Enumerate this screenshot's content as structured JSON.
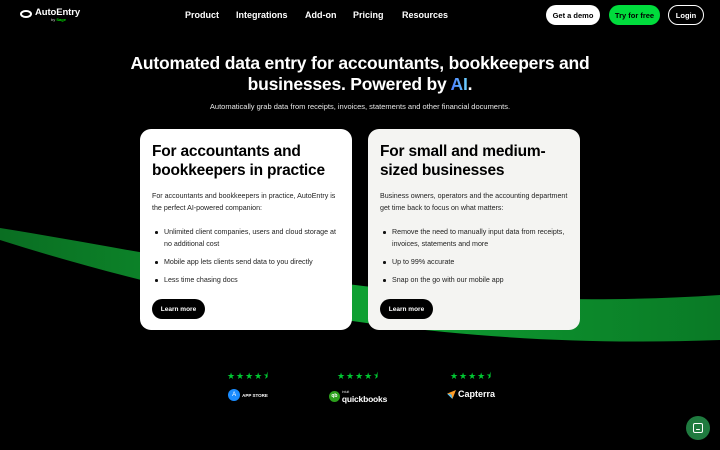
{
  "nav": {
    "logo_text": "AutoEntry",
    "logo_by": "by",
    "logo_sage": "Sage",
    "links": [
      "Product",
      "Integrations",
      "Add-on",
      "Pricing",
      "Resources"
    ],
    "get_demo": "Get a demo",
    "try_free": "Try for free",
    "login": "Login"
  },
  "hero": {
    "title_line1": "Automated data entry for accountants, bookkeepers and",
    "title_line2_a": "businesses. Powered by ",
    "title_line2_ai": "AI",
    "title_line2_b": ".",
    "subtitle": "Automatically grab data from receipts, invoices, statements and other financial documents."
  },
  "cards": [
    {
      "title": "For accountants and bookkeepers in practice",
      "description": "For accountants and bookkeepers in practice, AutoEntry is the perfect AI-powered companion:",
      "bullets": [
        "Unlimited client companies, users and cloud storage at no additional cost",
        "Mobile app lets clients send data to you directly",
        "Less time chasing docs"
      ],
      "button": "Learn more"
    },
    {
      "title": "For small and medium-sized businesses",
      "description": "Business owners, operators and the accounting department get time back to focus on what matters:",
      "bullets": [
        "Remove the need to manually input data from receipts, invoices, statements and more",
        "Up to 99% accurate",
        "Snap on the go with our mobile app"
      ],
      "button": "Learn more"
    }
  ],
  "ratings": [
    {
      "stars": "★★★★⯨",
      "brand": "APP STORE"
    },
    {
      "stars": "★★★★⯨",
      "brand_small": "intuit",
      "brand": "quickbooks"
    },
    {
      "stars": "★★★★⯨",
      "brand": "Capterra"
    }
  ],
  "colors": {
    "accent_green": "#00dc3c",
    "background": "#000000"
  },
  "icons": {
    "chat": "chat-icon"
  }
}
